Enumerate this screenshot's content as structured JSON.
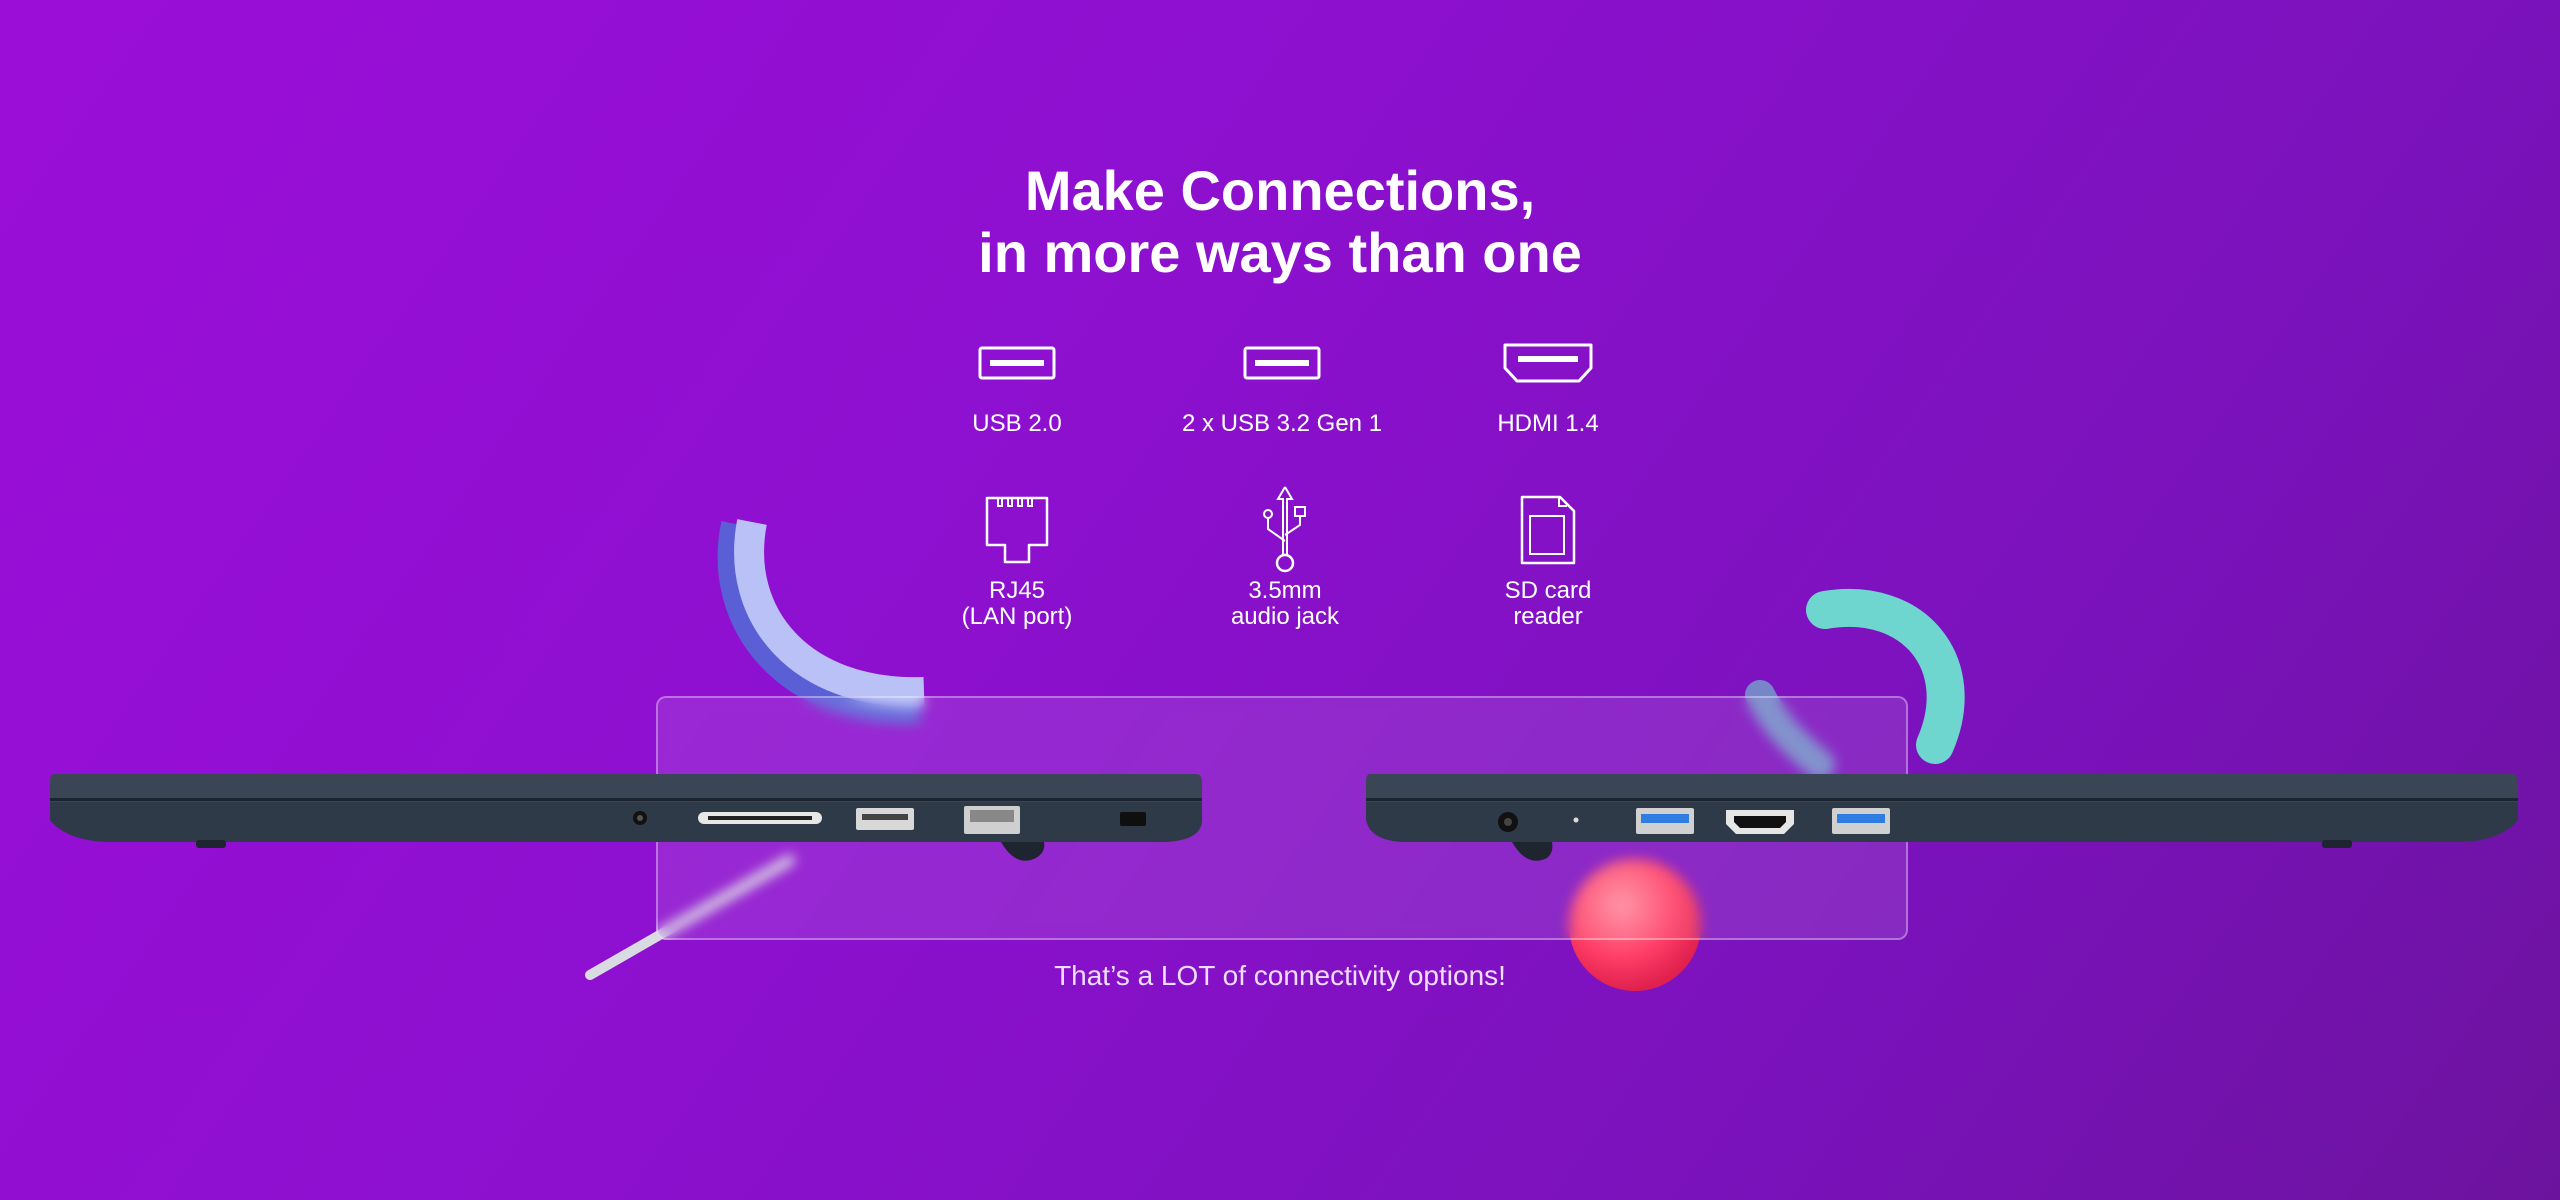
{
  "headline": {
    "line1": "Make Connections,",
    "line2": "in more ways than one"
  },
  "features": [
    {
      "icon": "usb-icon",
      "label_lines": [
        "USB 2.0"
      ]
    },
    {
      "icon": "usb-icon",
      "label_lines": [
        "2 x USB 3.2 Gen 1"
      ]
    },
    {
      "icon": "hdmi-icon",
      "label_lines": [
        "HDMI 1.4"
      ]
    },
    {
      "icon": "rj45-icon",
      "label_lines": [
        "RJ45",
        "(LAN port)"
      ]
    },
    {
      "icon": "usb-symbol-icon",
      "label_lines": [
        "3.5mm",
        "audio jack"
      ]
    },
    {
      "icon": "sd-card-icon",
      "label_lines": [
        "SD card",
        "reader"
      ]
    }
  ],
  "tagline": "That’s a LOT of connectivity options!",
  "colors": {
    "background_start": "#9b0ed8",
    "background_end": "#6c139e",
    "accent_blue": "#aab4f5",
    "accent_teal": "#6fd6cf",
    "accent_pink": "#ff4d6d",
    "laptop_body": "#2e3a48"
  }
}
